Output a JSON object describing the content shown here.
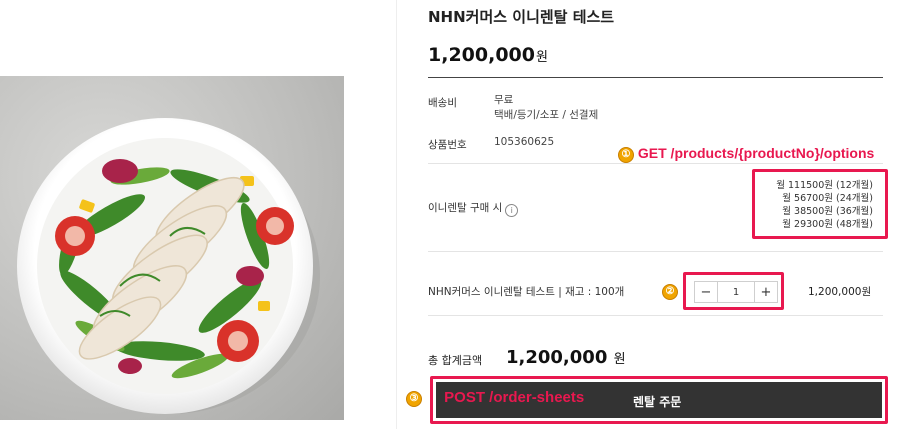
{
  "product": {
    "title": "NHN커머스 이니렌탈 테스트",
    "price_amount": "1,200,000",
    "price_unit": "원"
  },
  "shipping": {
    "label": "배송비",
    "value_main": "무료",
    "value_sub": "택배/등기/소포 / 선결제"
  },
  "product_no": {
    "label": "상품번호",
    "value": "105360625"
  },
  "rental": {
    "label": "이니렌탈 구매 시",
    "info_icon": "i",
    "plans": [
      "월 111500원 (12개월)",
      "월 56700원 (24개월)",
      "월 38500원 (36개월)",
      "월 29300원 (48개월)"
    ]
  },
  "option": {
    "name": "NHN커머스 이니렌탈 테스트 | 재고 : 100개",
    "minus_label": "−",
    "plus_label": "+",
    "quantity": "1",
    "price": "1,200,000원"
  },
  "total": {
    "label": "총 합계금액",
    "amount": "1,200,000",
    "unit": "원"
  },
  "order": {
    "button_label": "렌탈 주문"
  },
  "annotations": {
    "a1_number": "①",
    "a1_text": "GET /products/{productNo}/options",
    "a2_number": "②",
    "a3_number": "③",
    "a3_text": "POST /order-sheets",
    "color": "#e8184f",
    "marker_color": "#f0a400"
  },
  "colors": {
    "button_bg": "#333333",
    "text": "#222222"
  }
}
